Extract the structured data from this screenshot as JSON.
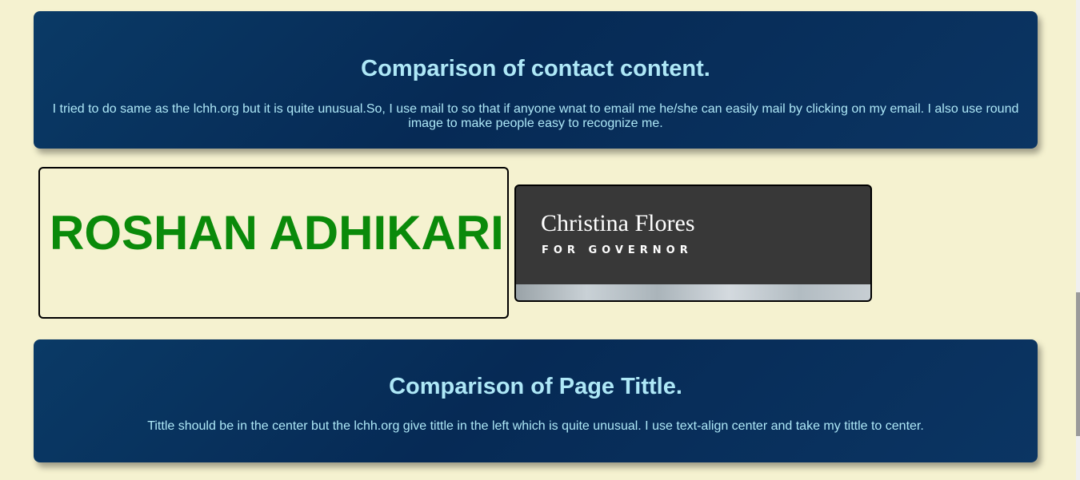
{
  "contact_section": {
    "heading": "Comparison of contact content.",
    "body": "I tried to do same as the lchh.org but it is quite unusual.So, I use mail to so that if anyone wnat to email me he/she can easily mail by clicking on my email. I also use round image to make people easy to recognize me."
  },
  "my_header": {
    "name": "ROSHAN ADHIKARI",
    "name_color": "#0a8a0a"
  },
  "reference_header": {
    "logo_name": "Christina Flores",
    "logo_tagline": "FOR GOVERNOR"
  },
  "title_section": {
    "heading": "Comparison of Page Tittle.",
    "body": "Tittle should be in the center but the lchh.org give tittle in the left which is quite unusual. I use text-align center and take my tittle to center."
  },
  "colors": {
    "page_background": "#f5f2d0",
    "panel_background": "#062a55",
    "panel_text": "#aee8f7",
    "logo_background": "#383838"
  }
}
